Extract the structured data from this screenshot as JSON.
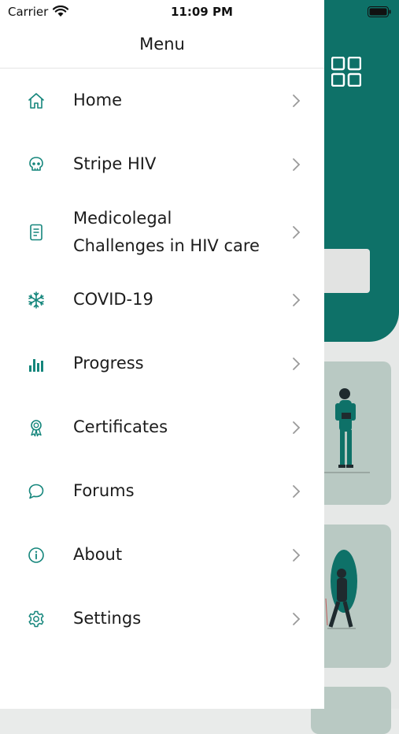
{
  "status_bar": {
    "carrier": "Carrier",
    "time": "11:09 PM"
  },
  "drawer": {
    "title": "Menu",
    "items": [
      {
        "label": "Home",
        "icon": "home-icon"
      },
      {
        "label": "Stripe HIV",
        "icon": "skull-icon"
      },
      {
        "label_line1": "Medicolegal",
        "label_line2": "Challenges in HIV care",
        "icon": "document-icon"
      },
      {
        "label": "COVID-19",
        "icon": "snowflake-icon"
      },
      {
        "label": "Progress",
        "icon": "bar-chart-icon"
      },
      {
        "label": "Certificates",
        "icon": "award-icon"
      },
      {
        "label": "Forums",
        "icon": "chat-icon"
      },
      {
        "label": "About",
        "icon": "info-icon"
      },
      {
        "label": "Settings",
        "icon": "gear-icon"
      }
    ]
  },
  "colors": {
    "accent": "#0e7168",
    "icon": "#15867c",
    "card": "#b9c9c3"
  }
}
